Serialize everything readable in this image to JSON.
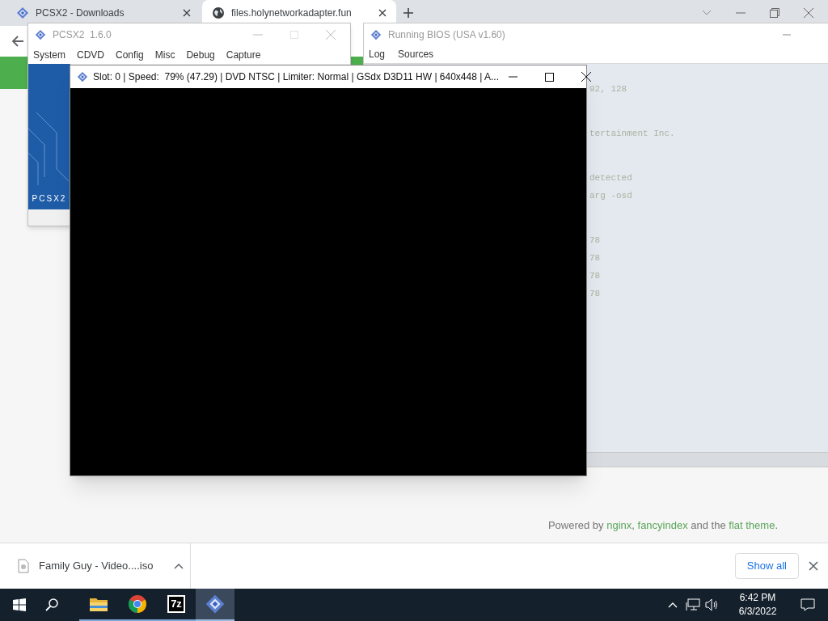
{
  "browser": {
    "tabs": [
      {
        "title": "PCSX2 - Downloads",
        "selected": false,
        "kind": "pcsx2"
      },
      {
        "title": "files.holynetworkadapter.fun",
        "selected": true,
        "kind": "globe"
      }
    ],
    "footer": [
      {
        "kind": "text",
        "text": "Powered by "
      },
      {
        "kind": "link",
        "text": "nginx"
      },
      {
        "kind": "text",
        "text": ", "
      },
      {
        "kind": "link",
        "text": "fancyindex"
      },
      {
        "kind": "text",
        "text": " and the "
      },
      {
        "kind": "link",
        "text": "flat theme"
      },
      {
        "kind": "text",
        "text": "."
      }
    ],
    "download": {
      "file": "Family Guy - Video....iso",
      "show_all": "Show all"
    }
  },
  "pcsx2_window": {
    "title": "PCSX2  1.6.0",
    "menu": [
      "System",
      "CDVD",
      "Config",
      "Misc",
      "Debug",
      "Capture"
    ],
    "banner": "PCSX2"
  },
  "log_window": {
    "title": "Running BIOS (USA v1.60)",
    "menu": [
      "Log",
      "Sources"
    ],
    "line_groups": [
      [
        "92, 128"
      ],
      [
        "tertainment Inc."
      ],
      [
        "detected",
        "arg -osd"
      ],
      [
        "78",
        "78",
        "78",
        "78"
      ]
    ]
  },
  "gs_window": {
    "title": "Slot: 0 | Speed:  79% (47.29) | DVD NTSC | Limiter: Normal | GSdx D3D11 HW | 640x448 | A..."
  },
  "taskbar": {
    "apps": [
      {
        "kind": "folder",
        "selected": false
      },
      {
        "kind": "chrome",
        "selected": false
      },
      {
        "kind": "sevenzip",
        "label": "7z",
        "selected": false
      },
      {
        "kind": "pcsx2",
        "selected": true
      }
    ],
    "time": "6:42 PM",
    "date": "6/3/2022"
  }
}
